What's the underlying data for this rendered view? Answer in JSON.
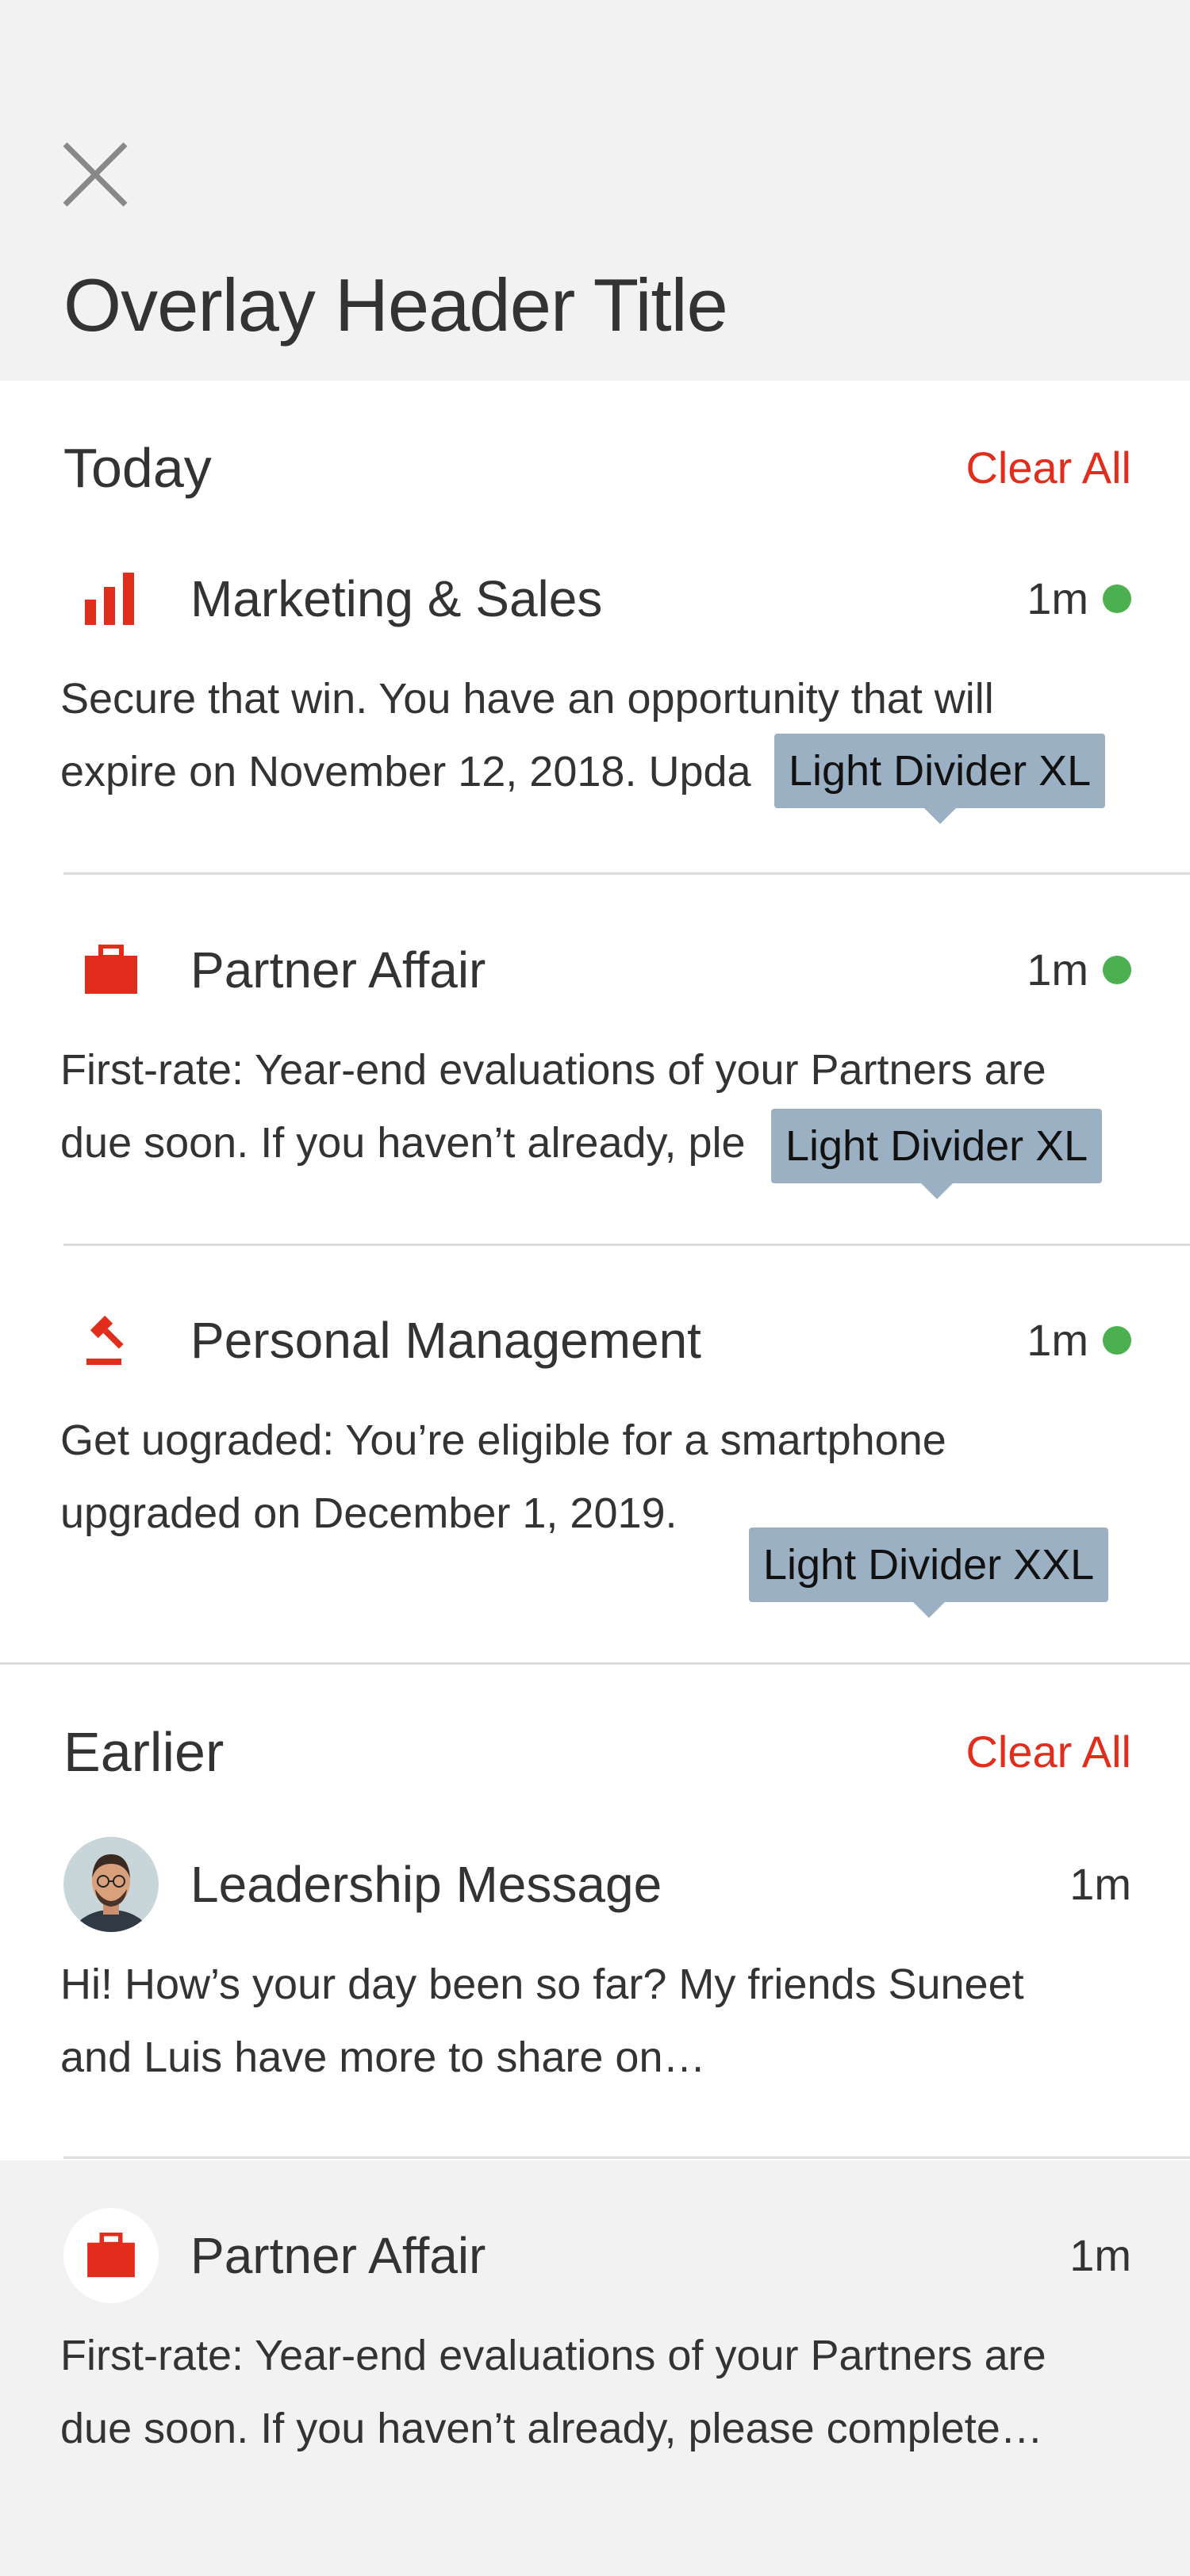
{
  "overlay": {
    "title": "Overlay Header Title",
    "close_icon": "close-icon"
  },
  "sections": {
    "today": {
      "title": "Today",
      "clear_all": "Clear All",
      "items": [
        {
          "icon": "bar-chart-icon",
          "title": "Marketing & Sales",
          "time": "1m",
          "unread": true,
          "body": "Secure that win. You have an opportunity that will\nexpire on November 12, 2018. Upda",
          "tooltip": "Light Divider XL"
        },
        {
          "icon": "briefcase-icon",
          "title": "Partner Affair",
          "time": "1m",
          "unread": true,
          "body": "First-rate: Year-end evaluations of your Partners are\ndue soon. If you haven’t already, ple",
          "tooltip": "Light Divider XL"
        },
        {
          "icon": "gavel-icon",
          "title": "Personal Management",
          "time": "1m",
          "unread": true,
          "body": "Get uograded: You’re eligible for a smartphone\nupgraded on December 1, 2019.",
          "tooltip": "Light Divider XXL"
        }
      ]
    },
    "earlier": {
      "title": "Earlier",
      "clear_all": "Clear All",
      "items": [
        {
          "icon": "avatar",
          "title": "Leadership Message",
          "time": "1m",
          "unread": false,
          "body": "Hi! How’s your day been so far? My friends Suneet\nand Luis have more to share on…"
        },
        {
          "icon": "briefcase-icon",
          "title": "Partner Affair",
          "time": "1m",
          "unread": false,
          "body": "First-rate: Year-end evaluations of your Partners are\ndue soon. If you haven’t already, please complete…"
        }
      ]
    }
  },
  "colors": {
    "accent": "#e22d1d",
    "unread": "#4caf50",
    "background": "#f2f2f2",
    "tooltip": "#9bb0c2"
  }
}
